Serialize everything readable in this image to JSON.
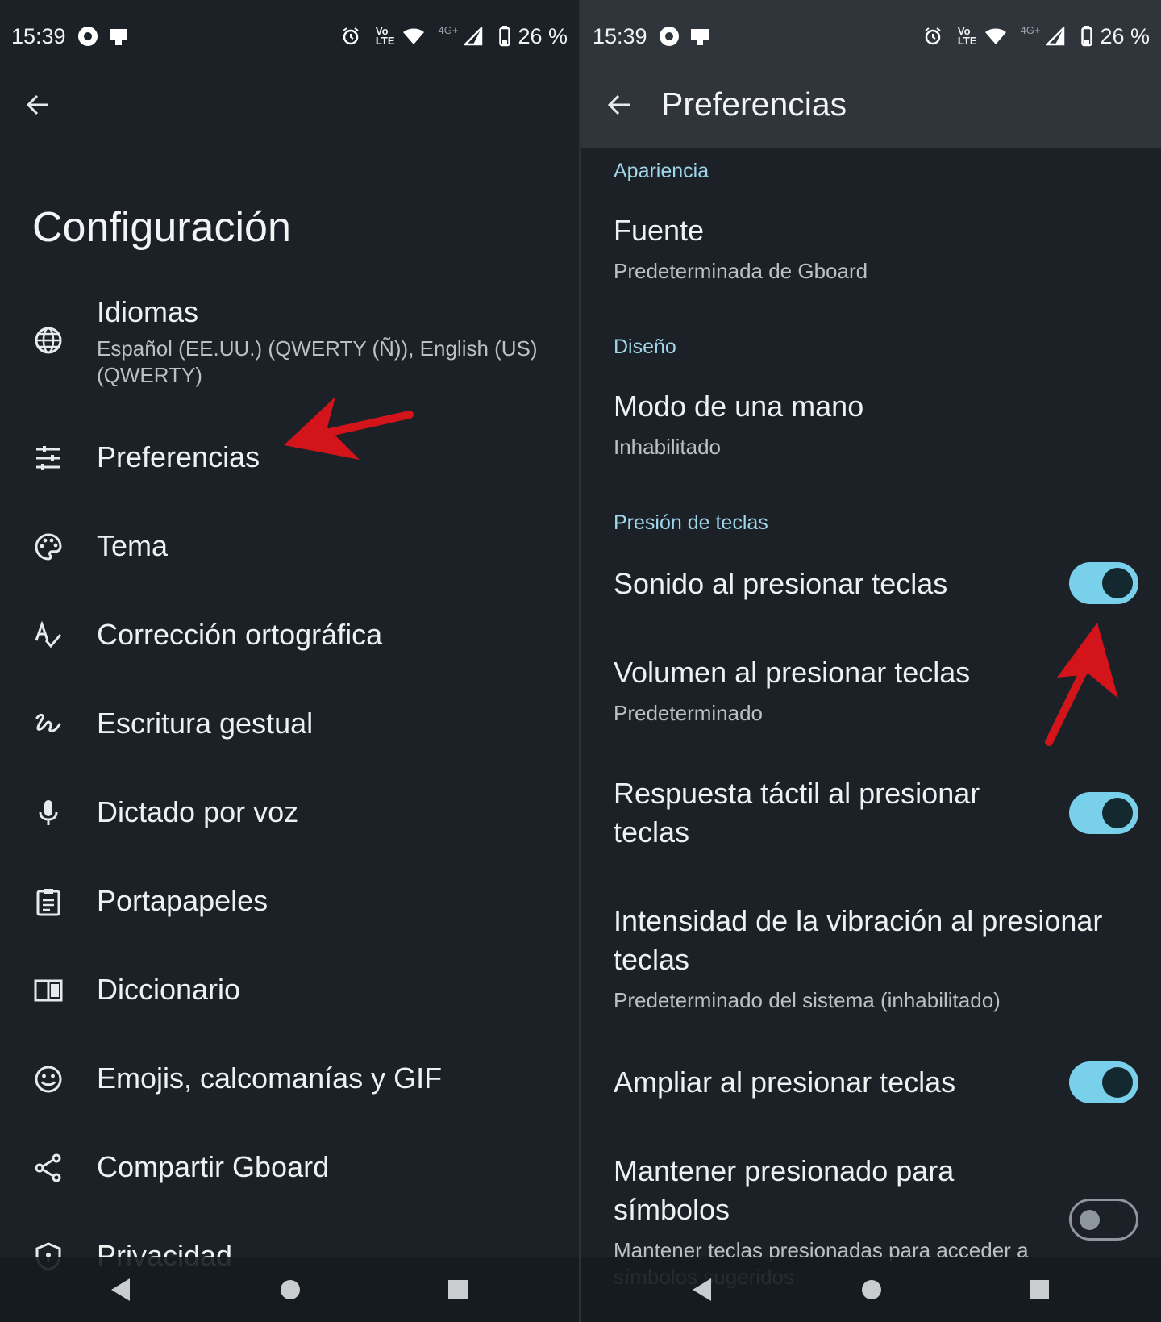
{
  "status_bar": {
    "time": "15:39",
    "battery": "26 %",
    "network": "4G+"
  },
  "left": {
    "title": "Configuración",
    "items": [
      {
        "label": "Idiomas",
        "sub": "Español (EE.UU.) (QWERTY (Ñ)), English (US) (QWERTY)",
        "icon": "globe-icon"
      },
      {
        "label": "Preferencias",
        "icon": "sliders-icon"
      },
      {
        "label": "Tema",
        "icon": "palette-icon"
      },
      {
        "label": "Corrección ortográfica",
        "icon": "spellcheck-icon"
      },
      {
        "label": "Escritura gestual",
        "icon": "gesture-icon"
      },
      {
        "label": "Dictado por voz",
        "icon": "mic-icon"
      },
      {
        "label": "Portapapeles",
        "icon": "clipboard-icon"
      },
      {
        "label": "Diccionario",
        "icon": "book-icon"
      },
      {
        "label": "Emojis, calcomanías y GIF",
        "icon": "smiley-icon"
      },
      {
        "label": "Compartir Gboard",
        "icon": "share-icon"
      },
      {
        "label": "Privacidad",
        "icon": "shield-icon"
      }
    ]
  },
  "right": {
    "title": "Preferencias",
    "sections": {
      "apariencia": "Apariencia",
      "diseno": "Diseño",
      "presion": "Presión de teclas"
    },
    "items": {
      "fuente": {
        "label": "Fuente",
        "sub": "Predeterminada de Gboard"
      },
      "modo_mano": {
        "label": "Modo de una mano",
        "sub": "Inhabilitado"
      },
      "sonido": {
        "label": "Sonido al presionar teclas",
        "on": true
      },
      "volumen": {
        "label": "Volumen al presionar teclas",
        "sub": "Predeterminado"
      },
      "tactil": {
        "label": "Respuesta táctil al presionar teclas",
        "on": true
      },
      "vibracion": {
        "label": "Intensidad de la vibración al presionar teclas",
        "sub": "Predeterminado del sistema (inhabilitado)"
      },
      "ampliar": {
        "label": "Ampliar al presionar teclas",
        "on": true
      },
      "mantener": {
        "label": "Mantener presionado para símbolos",
        "sub": "Mantener teclas presionadas para acceder a símbolos sugeridos",
        "on": false
      }
    }
  },
  "colors": {
    "background": "#1b2126",
    "toolbar": "#2f353a",
    "accent": "#79d0ea",
    "section_text": "#9fd6ea",
    "annotation_arrow": "#d3141b"
  }
}
